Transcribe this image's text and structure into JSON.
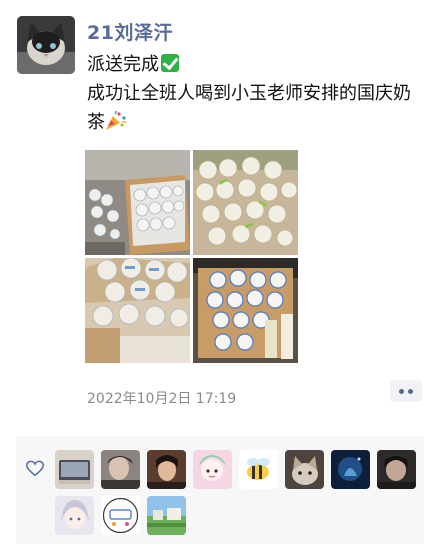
{
  "post": {
    "author": "21刘泽汗",
    "line1": "派送完成",
    "line2": "成功让全班人喝到小玉老师安排的国庆奶茶",
    "timestamp": "2022年10月2日 17:19"
  },
  "icons": {
    "check": "check-mark-button-emoji",
    "popper": "party-popper-emoji",
    "heart": "heart-outline-icon",
    "more": "more-dots-icon"
  },
  "colors": {
    "author": "#576b95",
    "text": "#111111",
    "time": "#8a8a8a",
    "panel": "#f7f7f7"
  },
  "likes": {
    "avatars": [
      "liker-1",
      "liker-2",
      "liker-3",
      "liker-4",
      "liker-5",
      "liker-6",
      "liker-7",
      "liker-8",
      "liker-9",
      "liker-10",
      "liker-11"
    ]
  }
}
